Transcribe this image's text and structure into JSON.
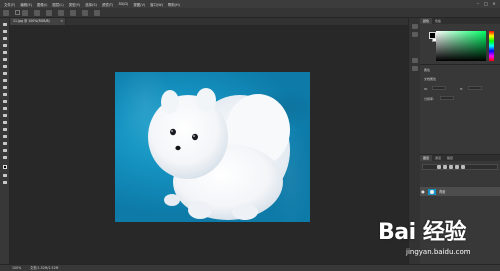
{
  "menubar": {
    "items": [
      "文件(F)",
      "编辑(E)",
      "图像(I)",
      "图层(L)",
      "类型(Y)",
      "选择(S)",
      "滤镜(T)",
      "3D(D)",
      "视图(V)",
      "窗口(W)",
      "帮助(H)"
    ],
    "window_buttons": [
      "–",
      "□",
      "×"
    ]
  },
  "document": {
    "tab_label": "11.jpg @ 100%(RGB/8)",
    "close_glyph": "×"
  },
  "panels": {
    "tabs_top": [
      "颜色",
      "色板"
    ],
    "properties_label": "属性",
    "prop_rows": [
      "文档属性",
      "W:",
      "H:",
      "分辨率:"
    ],
    "layers_tabs": [
      "图层",
      "通道",
      "路径"
    ],
    "layer": {
      "name": "背景",
      "eye": "●"
    }
  },
  "statusbar": {
    "zoom": "100%",
    "doc_info": "文档:1.52M/1.52M"
  },
  "watermark": {
    "logo": "Bai 经验",
    "url": "jingyan.baidu.com"
  },
  "colors": {
    "photo_bg": "#1592c0",
    "foreground": "#000000",
    "background": "#ffffff"
  }
}
